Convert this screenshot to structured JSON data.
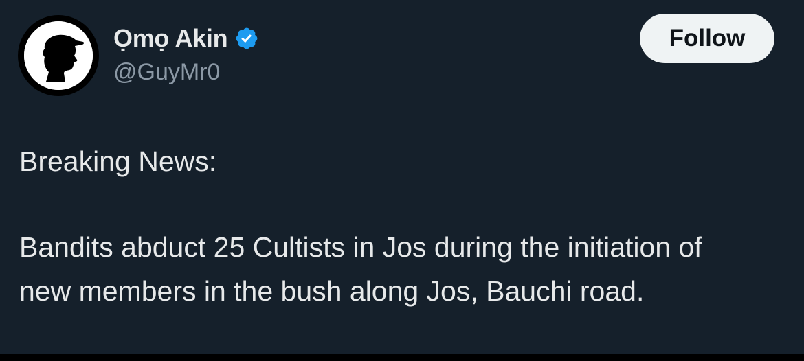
{
  "user": {
    "display_name": "Ọmọ Akin",
    "handle": "@GuyMr0",
    "avatar_icon": "silhouette-cap-icon",
    "verified_icon": "verified-badge-icon",
    "verified_color": "#1d9bf0"
  },
  "follow_button": {
    "label": "Follow"
  },
  "tweet": {
    "lines": [
      "Breaking News:",
      "Bandits abduct 25 Cultists in Jos during the initiation of",
      "new members in the bush along Jos, Bauchi road."
    ]
  },
  "colors": {
    "background": "#15202b",
    "text_primary": "#e7e9ea",
    "text_secondary": "#8b98a5",
    "button_bg": "#eff3f4",
    "button_text": "#0f1419"
  }
}
